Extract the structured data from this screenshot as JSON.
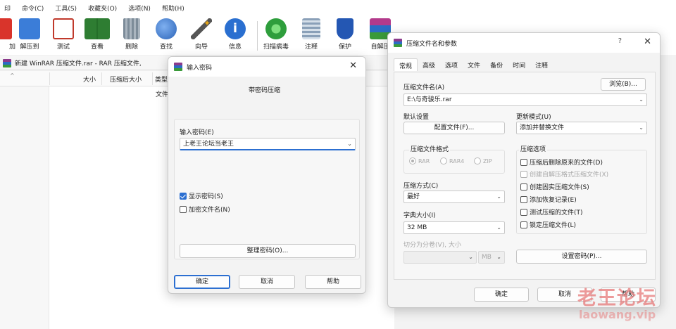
{
  "menu": [
    "命令(C)",
    "工具(S)",
    "收藏夹(O)",
    "选项(N)",
    "帮助(H)"
  ],
  "menu_lead": "印",
  "toolbar": {
    "items": [
      {
        "label": "加",
        "icon": "add-icon",
        "color": "#d9342b"
      },
      {
        "label": "解压到",
        "icon": "folder-extract-icon",
        "color": "#3b7dd8"
      },
      {
        "label": "测试",
        "icon": "test-icon",
        "color": "#c0392b"
      },
      {
        "label": "查看",
        "icon": "view-book-icon",
        "color": "#2e7d32"
      },
      {
        "label": "删除",
        "icon": "trash-icon",
        "color": "#6b7c8c"
      },
      {
        "label": "查找",
        "icon": "magnifier-icon",
        "color": "#2a63b8"
      },
      {
        "label": "向导",
        "icon": "wizard-wand-icon",
        "color": "#e6a617"
      },
      {
        "label": "信息",
        "icon": "info-icon",
        "color": "#2a6fd0"
      },
      {
        "label": "扫描病毒",
        "icon": "virus-scan-icon",
        "color": "#2e9e3c"
      },
      {
        "label": "注释",
        "icon": "comment-icon",
        "color": "#5a6e86"
      },
      {
        "label": "保护",
        "icon": "shield-icon",
        "color": "#2457b3"
      },
      {
        "label": "自解压",
        "icon": "sfx-archive-icon",
        "color": "#b33a8b"
      }
    ]
  },
  "pathbar": {
    "text": "新建 WinRAR 压缩文件.rar - RAR 压缩文件,"
  },
  "columns": {
    "c1": "大小",
    "c2": "压缩后大小",
    "c3": "类型",
    "c4": "文件"
  },
  "password_dialog": {
    "title": "输入密码",
    "heading": "带密码压缩",
    "field_label": "输入密码(E)",
    "password_value": "上老王论坛当老王",
    "show_password": "显示密码(S)",
    "show_password_checked": true,
    "encrypt_names": "加密文件名(N)",
    "encrypt_names_checked": false,
    "organize_btn": "整理密码(O)...",
    "ok": "确定",
    "cancel": "取消",
    "help": "帮助"
  },
  "archive_dialog": {
    "title": "压缩文件名和参数",
    "help_glyph": "?",
    "tabs": [
      "常规",
      "高级",
      "选项",
      "文件",
      "备份",
      "时间",
      "注释"
    ],
    "active_tab": "常规",
    "archive_name_label": "压缩文件名(A)",
    "archive_name_value": "E:\\与奇骏乐.rar",
    "browse": "浏览(B)...",
    "default_settings": "默认设置",
    "profiles_btn": "配置文件(F)...",
    "update_mode_label": "更新模式(U)",
    "update_mode_value": "添加并替换文件",
    "format_label": "压缩文件格式",
    "formats": [
      "RAR",
      "RAR4",
      "ZIP"
    ],
    "selected_format": "RAR",
    "method_label": "压缩方式(C)",
    "method_value": "最好",
    "dict_label": "字典大小(I)",
    "dict_value": "32 MB",
    "split_label": "切分为分卷(V), 大小",
    "split_unit": "MB",
    "options_label": "压缩选项",
    "options": [
      {
        "label": "压缩后删除原来的文件(D)",
        "checked": false,
        "enabled": true
      },
      {
        "label": "创建自解压格式压缩文件(X)",
        "checked": false,
        "enabled": false
      },
      {
        "label": "创建固实压缩文件(S)",
        "checked": false,
        "enabled": true
      },
      {
        "label": "添加恢复记录(E)",
        "checked": false,
        "enabled": true
      },
      {
        "label": "测试压缩的文件(T)",
        "checked": false,
        "enabled": true
      },
      {
        "label": "锁定压缩文件(L)",
        "checked": false,
        "enabled": true
      }
    ],
    "set_password": "设置密码(P)...",
    "ok": "确定",
    "cancel": "取消",
    "help": "帮助"
  },
  "watermark": {
    "cn": "老王论坛",
    "en": "laowang.vip"
  },
  "colors": {
    "accent": "#2c6fd1",
    "dialog_bg": "#f3f3f3",
    "watermark": "#e67878"
  }
}
